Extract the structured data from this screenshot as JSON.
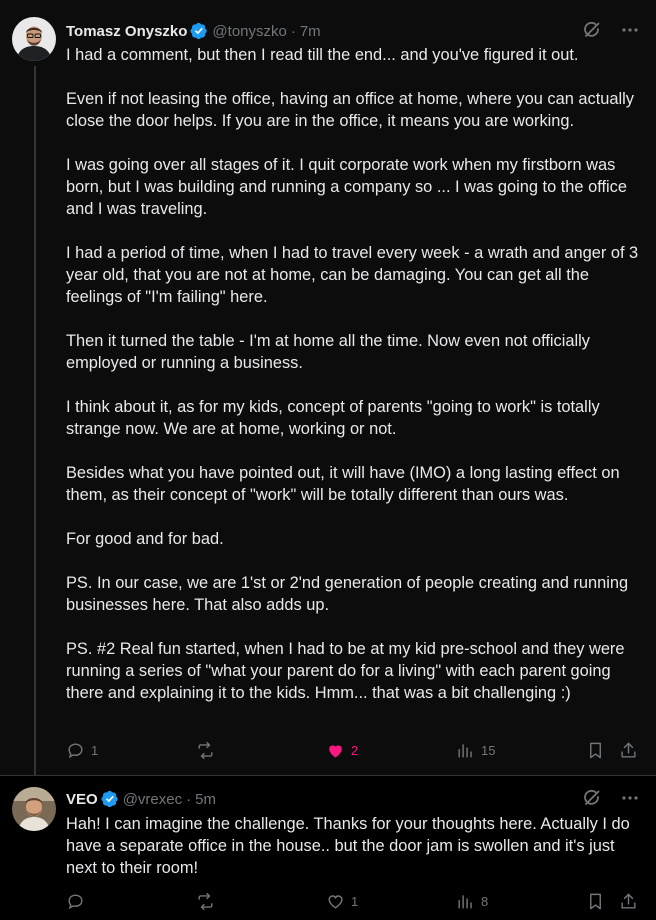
{
  "tweets": [
    {
      "author": {
        "name": "Tomasz Onyszko",
        "handle": "@tonyszko",
        "time": "7m",
        "verified": true
      },
      "body": [
        "I had a comment, but then I read till the end... and you've figured it out.",
        "Even if not leasing the office, having an office at home, where you can actually close the door helps. If you are in the office, it means you are working.",
        "I was going over all stages of it. I quit corporate work when my firstborn was born, but I was building and running a company so ... I was going to the office and I was traveling.",
        "I had a period of time, when I had to travel every week - a wrath and anger of 3 year old, that you are not at home, can be damaging. You can get all the feelings of \"I'm failing\" here.",
        "Then it turned the table - I'm at home all the time. Now even not officially employed or running a business.",
        "I think about it, as for my kids, concept of parents \"going to work\" is totally strange now. We are at home, working or not.",
        "Besides what you have pointed out, it will have (IMO) a long lasting effect on them, as their concept of \"work\" will be totally different than ours was.",
        "For good and for bad.",
        "PS. In our case, we are 1'st or 2'nd generation of people creating and running businesses here. That also adds up.",
        "PS. #2 Real fun started, when I had to be at my kid pre-school and they were running a series of \"what your parent do for a living\" with each parent going there and explaining it to the kids. Hmm... that was a bit challenging :)"
      ],
      "stats": {
        "replies": "1",
        "reposts": "",
        "likes": "2",
        "views": "15"
      },
      "liked": true
    },
    {
      "author": {
        "name": "VEO",
        "handle": "@vrexec",
        "time": "5m",
        "verified": true
      },
      "body": [
        "Hah! I can imagine the challenge. Thanks for your thoughts here. Actually I do have a separate office in the house.. but the door jam is swollen and it's just next to their room!"
      ],
      "stats": {
        "replies": "",
        "reposts": "",
        "likes": "1",
        "views": "8"
      },
      "liked": false
    }
  ],
  "colors": {
    "accent_verified": "#1d9bf0",
    "like_pink": "#f91880",
    "muted": "#71767b",
    "text": "#e7e9ea"
  },
  "icons": [
    "verified-badge-icon",
    "grok-icon",
    "more-icon",
    "reply-icon",
    "repost-icon",
    "like-icon",
    "views-icon",
    "bookmark-icon",
    "share-icon"
  ],
  "separator": "·"
}
